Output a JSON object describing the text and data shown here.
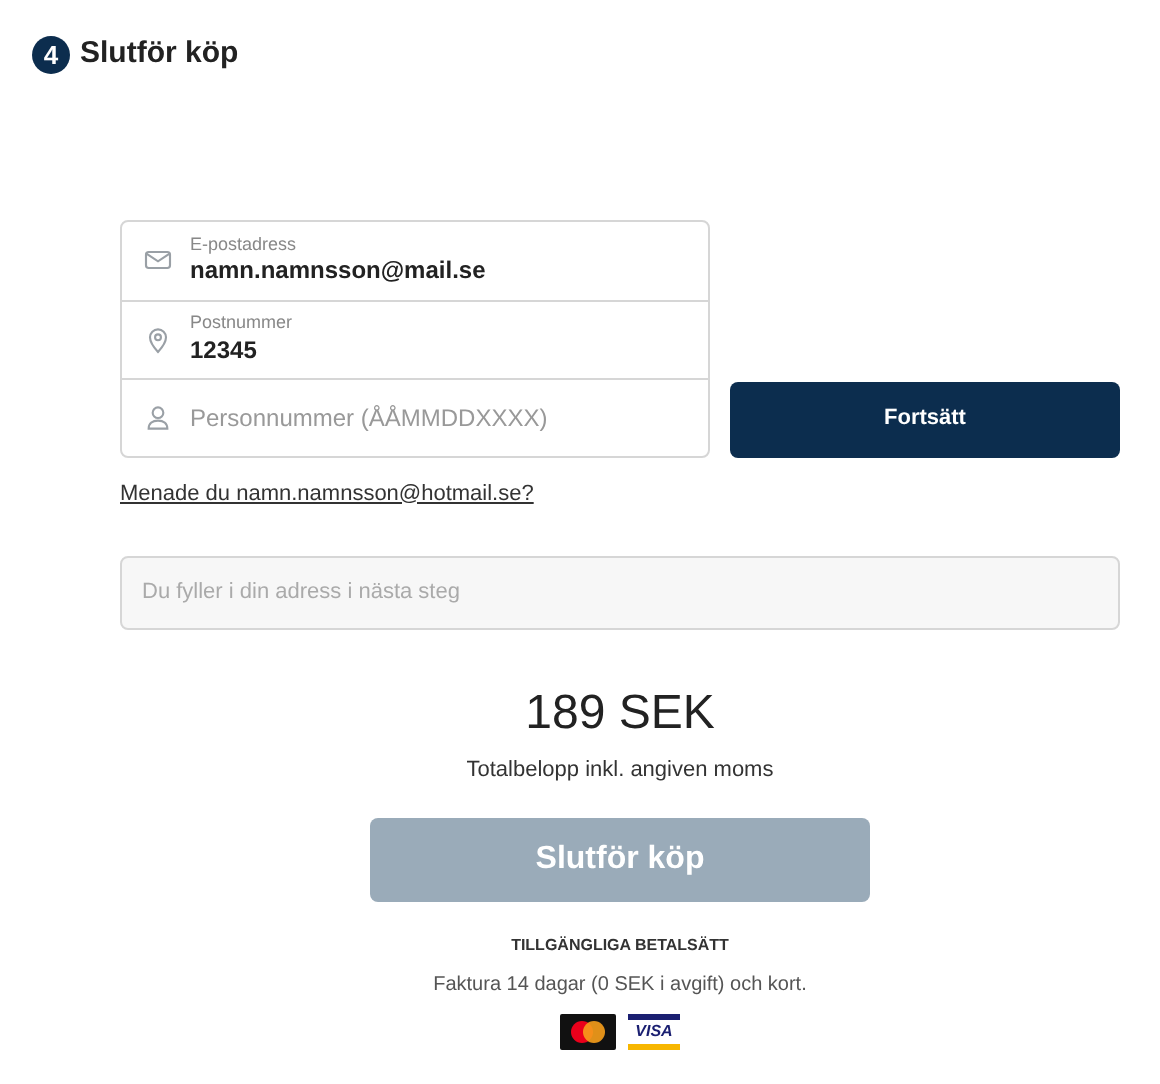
{
  "step": {
    "number": "4",
    "title": "Slutför köp"
  },
  "fields": [
    {
      "kind": "email",
      "label": "E-postadress",
      "value": "namn.namnsson@mail.se"
    },
    {
      "kind": "location",
      "label": "Postnummer",
      "value": "12345"
    },
    {
      "kind": "person",
      "placeholder": "Personnummer (ÅÅMMDDXXXX)"
    }
  ],
  "continue_button": "Fortsätt",
  "suggestion_link": "Menade du namn.namnsson@hotmail.se?",
  "address_field": {
    "placeholder": "Du fyller i din adress i nästa steg"
  },
  "total": {
    "amount": "189 SEK",
    "caption": "Totalbelopp inkl. angiven moms"
  },
  "submit_button": {
    "label": "Slutför köp",
    "disabled": true
  },
  "payment": {
    "heading": "TILLGÄNGLIGA BETALSÄTT",
    "text": "Faktura 14 dagar (0 SEK i avgift) och kort.",
    "cards": [
      {
        "kind": "mastercard"
      },
      {
        "kind": "visa",
        "label": "VISA"
      }
    ]
  }
}
